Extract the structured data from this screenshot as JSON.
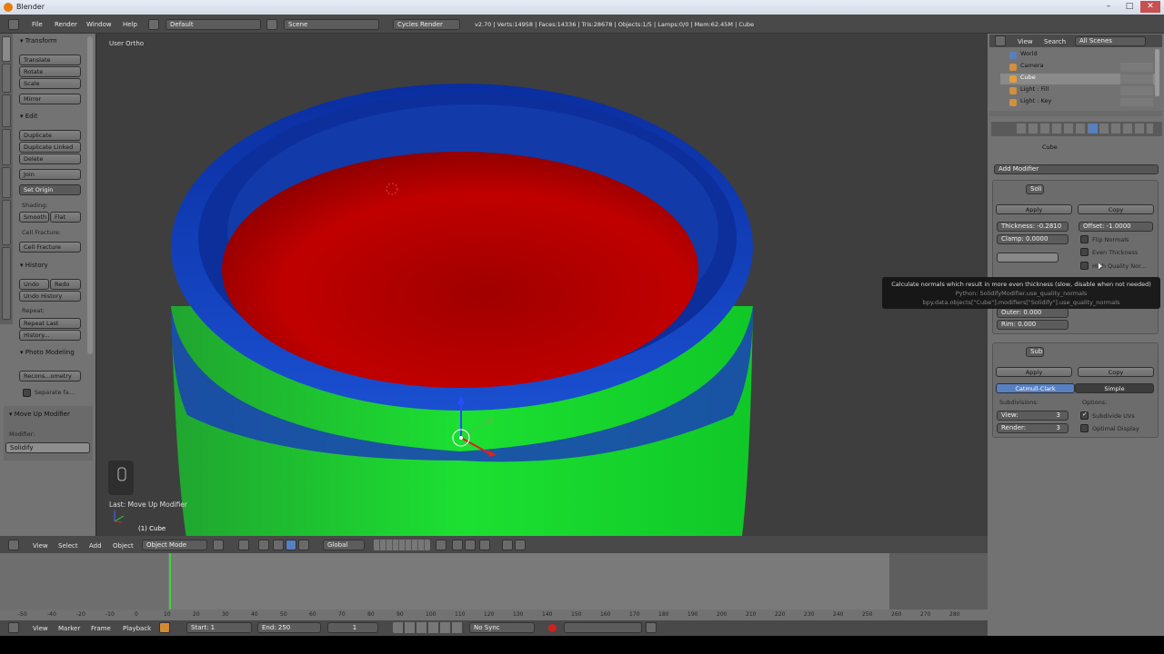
{
  "window": {
    "title": "Blender"
  },
  "topbar": {
    "menus": [
      "File",
      "Render",
      "Window",
      "Help"
    ],
    "screen_layout": "Default",
    "scene": "Scene",
    "engine": "Cycles Render",
    "stats": "v2.70 | Verts:14958 | Faces:14336 | Tris:28678 | Objects:1/5 | Lamps:0/0 | Mem:62.45M | Cube"
  },
  "toolshelf": {
    "tabs": [
      "Tools",
      "Create",
      "Relations",
      "Animation",
      "Physics",
      "Grease Pencil"
    ],
    "transform": {
      "header": "Transform",
      "buttons": [
        "Translate",
        "Rotate",
        "Scale",
        "Mirror"
      ]
    },
    "edit": {
      "header": "Edit",
      "buttons": [
        "Duplicate",
        "Duplicate Linked",
        "Delete",
        "Join"
      ],
      "set_origin": "Set Origin"
    },
    "shading": {
      "label": "Shading:",
      "smooth": "Smooth",
      "flat": "Flat"
    },
    "cell_fracture": {
      "label": "Cell Fracture:",
      "button": "Cell Fracture"
    },
    "history": {
      "header": "History",
      "undo": "Undo",
      "redo": "Redo",
      "undo_history": "Undo History",
      "repeat_label": "Repeat:",
      "repeat_last": "Repeat Last",
      "history": "History..."
    },
    "photomodeling": {
      "header": "Photo Modeling",
      "reconstruct": "Recons...ometry",
      "separate": "Separate fa..."
    },
    "operator": {
      "header": "Move Up Modifier",
      "modifier_label": "Modifier:",
      "modifier_value": "Solidify"
    }
  },
  "viewport": {
    "view_label": "User Ortho",
    "last_op": "Last: Move Up Modifier",
    "object_label": "(1) Cube",
    "colors": {
      "outer": "#17d82a",
      "rim": "#1448c8",
      "inner": "#c00000",
      "background": "#3e3e3e"
    }
  },
  "viewport_header": {
    "menus": [
      "View",
      "Select",
      "Add",
      "Object"
    ],
    "mode": "Object Mode",
    "orientation": "Global"
  },
  "outliner": {
    "menus": [
      "View",
      "Search"
    ],
    "filter": "All Scenes",
    "rows": [
      "World",
      "Camera",
      "Cube",
      "Light : Fill",
      "Light : Key"
    ]
  },
  "properties": {
    "context_object": "Cube",
    "add_modifier": "Add Modifier",
    "solidify": {
      "name": "Soli",
      "apply": "Apply",
      "copy": "Copy",
      "thickness": "Thickness: -0.2810",
      "offset": "Offset: -1.0000",
      "clamp": "Clamp: 0.0000",
      "flip_normals": "Flip Normals",
      "even_thickness": "Even Thickness",
      "high_quality": "High Quality Nor...",
      "outer": "Outer: 0.000",
      "rim": "Rim: 0.000"
    },
    "subsurf": {
      "name": "Subs",
      "apply": "Apply",
      "copy": "Copy",
      "catmull": "Catmull-Clark",
      "simple": "Simple",
      "subdivisions_label": "Subdivisions:",
      "options_label": "Options:",
      "view": "View:",
      "view_val": "3",
      "render": "Render:",
      "render_val": "3",
      "subdivide_uvs": "Subdivide UVs",
      "optimal_display": "Optimal Display"
    }
  },
  "tooltip": {
    "line1": "Calculate normals which result in more even thickness (slow, disable when not needed)",
    "line2": "Python: SolidifyModifier.use_quality_normals",
    "line3": "bpy.data.objects[\"Cube\"].modifiers[\"Solidify\"].use_quality_normals"
  },
  "timeline": {
    "ruler_ticks": [
      "-50",
      "-40",
      "-20",
      "-10",
      "0",
      "10",
      "20",
      "30",
      "40",
      "50",
      "60",
      "70",
      "80",
      "90",
      "100",
      "110",
      "120",
      "130",
      "140",
      "150",
      "160",
      "170",
      "180",
      "190",
      "200",
      "210",
      "220",
      "230",
      "240",
      "250",
      "260",
      "270",
      "280"
    ],
    "menus": [
      "View",
      "Marker",
      "Frame",
      "Playback"
    ],
    "start": "Start: 1",
    "end": "End: 250",
    "current": "1",
    "sync": "No Sync"
  }
}
